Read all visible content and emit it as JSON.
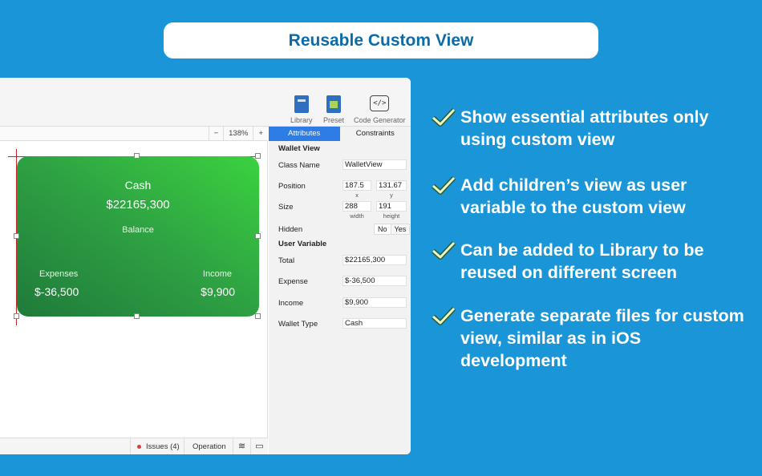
{
  "banner": {
    "title": "Reusable Custom View"
  },
  "toolbar": {
    "library_label": "Library",
    "preset_label": "Preset",
    "code_generator_label": "Code Generator",
    "code_icon_text": "</>"
  },
  "zoom": {
    "minus": "−",
    "level": "138%",
    "plus": "+"
  },
  "card": {
    "title": "Cash",
    "amount": "$22165,300",
    "balance_label": "Balance",
    "expenses_label": "Expenses",
    "expenses_value": "$-36,500",
    "income_label": "Income",
    "income_value": "$9,900",
    "gradient_colors": [
      "#1f7a3a",
      "#2ea043",
      "#3bd23f"
    ]
  },
  "statusbar": {
    "issues": "Issues (4)",
    "operation": "Operation",
    "layers_icon": "≋",
    "preview_icon": "▭"
  },
  "inspector": {
    "tabs": [
      "Attributes",
      "Constraints"
    ],
    "active_tab": "Attributes",
    "section_wallet": "Wallet View",
    "class_name_label": "Class Name",
    "class_name_value": "WalletView",
    "position_label": "Position",
    "position_x": "187.5",
    "position_y": "131.67",
    "x_label": "x",
    "y_label": "y",
    "size_label": "Size",
    "size_width": "288",
    "size_height": "191",
    "width_label": "width",
    "height_label": "height",
    "hidden_label": "Hidden",
    "hidden_no": "No",
    "hidden_yes": "Yes",
    "section_user_var": "User  Variable",
    "total_label": "Total",
    "total_value": "$22165,300",
    "expense_label": "Expense",
    "expense_value": "$-36,500",
    "income_label": "Income",
    "income_value": "$9,900",
    "wallet_type_label": "Wallet Type",
    "wallet_type_value": "Cash"
  },
  "features": [
    "Show essential attributes only using custom view",
    "Add children’s view as user variable to the custom view",
    "Can be added to Library to be reused on different screen",
    "Generate separate files for custom view, similar as in iOS development"
  ],
  "colors": {
    "background": "#1a96d8",
    "accent": "#2e7ce6",
    "title_text": "#0d6aa6"
  }
}
